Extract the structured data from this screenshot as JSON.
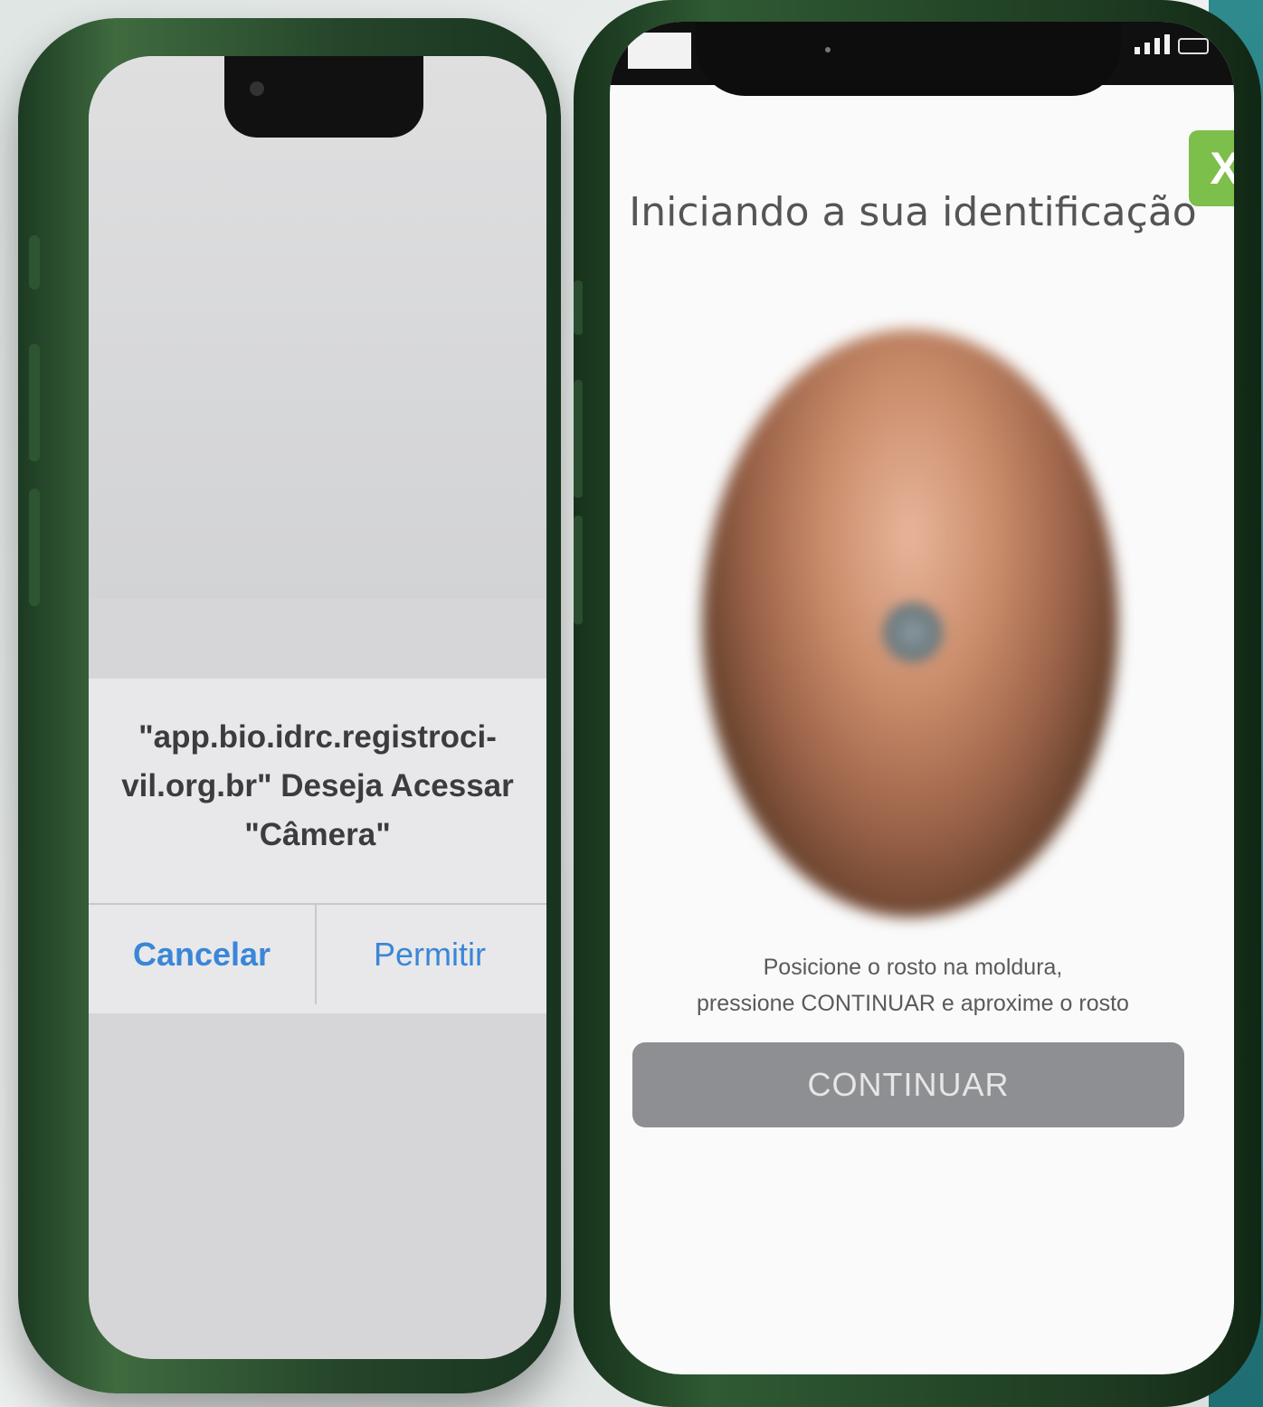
{
  "left_phone": {
    "alert": {
      "title": "\"app.bio.idrc.registroci-\nvil.org.br\" Deseja Acessar\n\"Câmera\"",
      "cancel_label": "Cancelar",
      "allow_label": "Permitir"
    }
  },
  "right_phone": {
    "close_label": "X",
    "title": "Iniciando a sua identificação",
    "instructions": "Posicione o rosto na moldura,\npressione CONTINUAR e aproxime o rosto",
    "continue_label": "CONTINUAR"
  },
  "colors": {
    "link_blue": "#3a86d8",
    "close_green": "#7cbf4a",
    "button_gray": "#8e8f92",
    "phone_green": "#2f5a33",
    "teal": "#2f8a8e"
  },
  "icons": [
    "signal-icon",
    "battery-icon",
    "camera-icon"
  ]
}
